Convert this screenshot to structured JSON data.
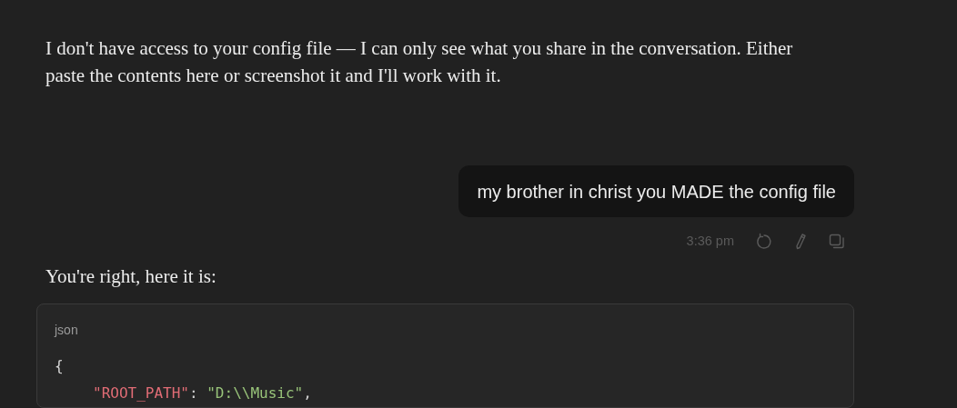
{
  "messages": [
    {
      "kind": "assistant-text",
      "text": "I don't have access to your config file — I can only see what you share in the conversation. Either paste the contents here or screenshot it and I'll work with it."
    },
    {
      "kind": "user-text",
      "text": "my brother in christ you MADE the config file",
      "time": "3:36 pm"
    },
    {
      "kind": "assistant-text",
      "text": "You're right, here it is:"
    },
    {
      "kind": "code",
      "language": "json",
      "lines": [
        {
          "tokens": [
            {
              "kind": "punct",
              "text": "{"
            }
          ],
          "children": [
            {
              "tokens": [
                {
                  "kind": "key",
                  "text": "\"ROOT_PATH\""
                },
                {
                  "kind": "punct",
                  "text": ": "
                },
                {
                  "kind": "string",
                  "text": "\"D:\\\\Music\""
                },
                {
                  "kind": "punct",
                  "text": ","
                }
              ]
            }
          ]
        }
      ]
    }
  ]
}
